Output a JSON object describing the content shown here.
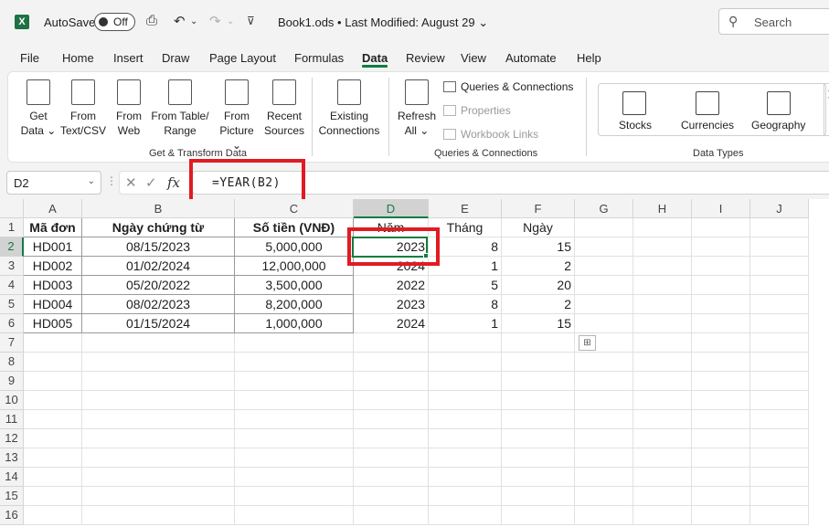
{
  "titlebar": {
    "autosave_label": "AutoSave",
    "autosave_state": "Off",
    "doc_title": "Book1.ods • Last Modified: August 29 ⌄",
    "search_placeholder": "Search"
  },
  "menu": {
    "items": [
      "File",
      "Home",
      "Insert",
      "Draw",
      "Page Layout",
      "Formulas",
      "Data",
      "Review",
      "View",
      "Automate",
      "Help"
    ],
    "active": "Data"
  },
  "ribbon": {
    "get_transform": {
      "buttons": [
        {
          "line1": "Get",
          "line2": "Data ⌄"
        },
        {
          "line1": "From",
          "line2": "Text/CSV"
        },
        {
          "line1": "From",
          "line2": "Web"
        },
        {
          "line1": "From Table/",
          "line2": "Range"
        },
        {
          "line1": "From",
          "line2": "Picture ⌄"
        },
        {
          "line1": "Recent",
          "line2": "Sources"
        },
        {
          "line1": "Existing",
          "line2": "Connections"
        }
      ],
      "label": "Get & Transform Data"
    },
    "queries": {
      "refresh_line1": "Refresh",
      "refresh_line2": "All ⌄",
      "queries_connections": "Queries & Connections",
      "properties": "Properties",
      "workbook_links": "Workbook Links",
      "label": "Queries & Connections"
    },
    "data_types": {
      "items": [
        "Stocks",
        "Currencies",
        "Geography"
      ],
      "label": "Data Types"
    }
  },
  "formula_bar": {
    "name_box": "D2",
    "fx": "fx",
    "formula": "=YEAR(B2)"
  },
  "sheet": {
    "columns": [
      "A",
      "B",
      "C",
      "D",
      "E",
      "F",
      "G",
      "H",
      "I",
      "J"
    ],
    "rows": [
      "1",
      "2",
      "3",
      "4",
      "5",
      "6",
      "7",
      "8",
      "9",
      "10",
      "11",
      "12",
      "13",
      "14",
      "15",
      "16"
    ],
    "headers": [
      "Mã đơn",
      "Ngày chứng từ",
      "Số tiền (VNĐ)",
      "Năm",
      "Tháng",
      "Ngày"
    ],
    "data": [
      [
        "HD001",
        "08/15/2023",
        "5,000,000",
        "2023",
        "8",
        "15"
      ],
      [
        "HD002",
        "01/02/2024",
        "12,000,000",
        "2024",
        "1",
        "2"
      ],
      [
        "HD003",
        "05/20/2022",
        "3,500,000",
        "2022",
        "5",
        "20"
      ],
      [
        "HD004",
        "08/02/2023",
        "8,200,000",
        "2023",
        "8",
        "2"
      ],
      [
        "HD005",
        "01/15/2024",
        "1,000,000",
        "2024",
        "1",
        "15"
      ]
    ],
    "active_cell": "D2"
  },
  "colors": {
    "accent": "#107c41",
    "highlight": "#e01b22"
  }
}
